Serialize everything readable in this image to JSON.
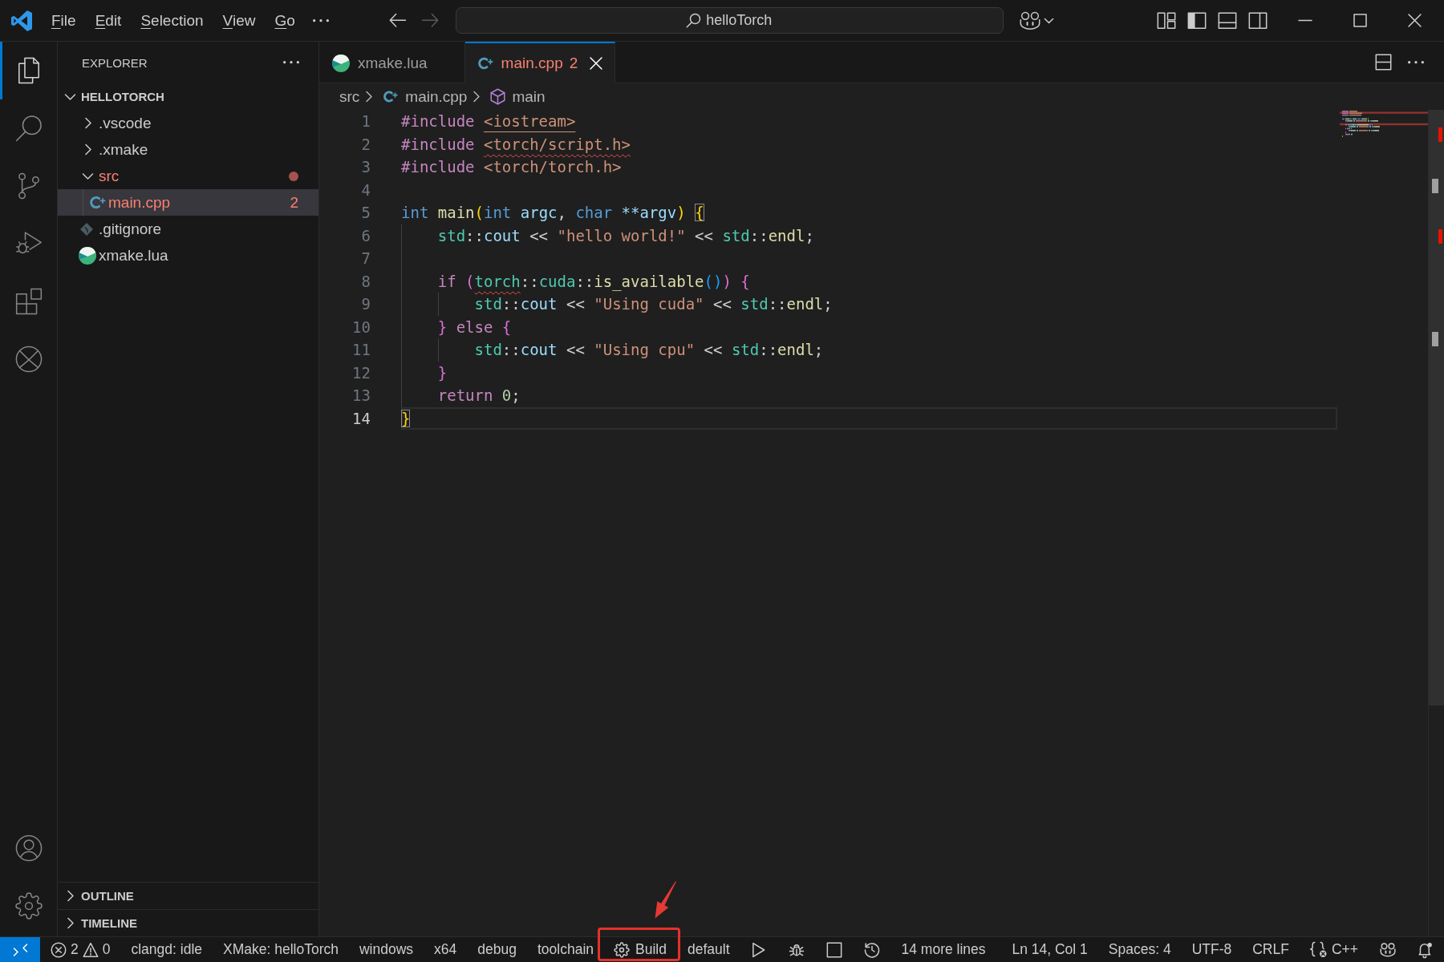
{
  "title_bar": {
    "menu": [
      "File",
      "Edit",
      "Selection",
      "View",
      "Go"
    ],
    "navigation": [
      {
        "kind": "back",
        "disabled": false
      },
      {
        "kind": "forward",
        "disabled": true
      }
    ],
    "command_center": {
      "label": "helloTorch"
    },
    "layout_toggles": [
      {
        "kind": "primary_sidebar",
        "on": true
      },
      {
        "kind": "panel",
        "on": false
      },
      {
        "kind": "secondary_sidebar",
        "on": false
      }
    ]
  },
  "activity_bar": {
    "items": [
      {
        "kind": "explorer",
        "selected": true
      },
      {
        "kind": "search",
        "selected": false
      },
      {
        "kind": "source_control",
        "selected": false
      },
      {
        "kind": "run_debug",
        "selected": false
      },
      {
        "kind": "extensions",
        "selected": false
      },
      {
        "kind": "xmake",
        "selected": false
      }
    ],
    "bottom": [
      {
        "kind": "accounts"
      },
      {
        "kind": "manage"
      }
    ]
  },
  "explorer": {
    "title": "EXPLORER",
    "sections": [
      {
        "title": "HELLOTORCH",
        "expanded": true,
        "tree": [
          {
            "label": ".vscode",
            "kind": "folder",
            "expanded": false,
            "selected": false,
            "error": false
          },
          {
            "label": ".xmake",
            "kind": "folder",
            "expanded": false,
            "selected": false,
            "error": false
          },
          {
            "label": "src",
            "kind": "folder",
            "expanded": true,
            "selected": false,
            "error": true,
            "children": [
              {
                "label": "main.cpp",
                "kind": "cpp",
                "selected": true,
                "error": true,
                "problems": "2"
              }
            ]
          },
          {
            "label": ".gitignore",
            "kind": "git",
            "selected": false,
            "error": false
          },
          {
            "label": "xmake.lua",
            "kind": "xmake",
            "selected": false,
            "error": false
          }
        ]
      },
      {
        "title": "OUTLINE",
        "expanded": false
      },
      {
        "title": "TIMELINE",
        "expanded": false
      }
    ]
  },
  "editor": {
    "tabs": [
      {
        "label": "xmake.lua",
        "kind": "xmake",
        "selected": false,
        "error": false
      },
      {
        "label": "main.cpp",
        "kind": "cpp",
        "selected": true,
        "error": true,
        "problems": "2"
      }
    ],
    "breadcrumbs": [
      {
        "label": "src",
        "kind": "folder"
      },
      {
        "label": "main.cpp",
        "kind": "cpp"
      },
      {
        "label": "main",
        "kind": "symbol"
      }
    ],
    "lines": [
      {
        "number": "1",
        "current": false,
        "tokens": [
          {
            "text": "#include ",
            "kind": "directive"
          },
          {
            "text": "<iostream>",
            "kind": "include_link"
          }
        ]
      },
      {
        "number": "2",
        "current": false,
        "tokens": [
          {
            "text": "#include ",
            "kind": "directive"
          },
          {
            "text": "<torch/script.h>",
            "kind": "include_error"
          }
        ]
      },
      {
        "number": "3",
        "current": false,
        "tokens": [
          {
            "text": "#include ",
            "kind": "directive"
          },
          {
            "text": "<torch/torch.h>",
            "kind": "include"
          }
        ]
      },
      {
        "number": "4",
        "current": false
      },
      {
        "number": "5",
        "current": false,
        "tokens": [
          {
            "text": "int ",
            "kind": "type"
          },
          {
            "text": "main",
            "kind": "function"
          },
          {
            "text": "(",
            "kind": "bracket1"
          },
          {
            "text": "int ",
            "kind": "type"
          },
          {
            "text": "argc",
            "kind": "param"
          },
          {
            "text": ", ",
            "kind": "plain"
          },
          {
            "text": "char ",
            "kind": "type"
          },
          {
            "text": "**argv",
            "kind": "param"
          },
          {
            "text": ") ",
            "kind": "bracket1"
          },
          {
            "text": "{",
            "kind": "bracket1_match"
          }
        ]
      },
      {
        "number": "6",
        "current": false,
        "tokens": [
          {
            "text": "    std",
            "kind": "namespace"
          },
          {
            "text": "::",
            "kind": "plain"
          },
          {
            "text": "cout",
            "kind": "variable"
          },
          {
            "text": " << ",
            "kind": "plain"
          },
          {
            "text": "\"hello world!\"",
            "kind": "string"
          },
          {
            "text": " << ",
            "kind": "plain"
          },
          {
            "text": "std",
            "kind": "namespace"
          },
          {
            "text": "::",
            "kind": "plain"
          },
          {
            "text": "endl",
            "kind": "function"
          },
          {
            "text": ";",
            "kind": "plain"
          }
        ]
      },
      {
        "number": "7",
        "current": false
      },
      {
        "number": "8",
        "current": false,
        "tokens": [
          {
            "text": "    if ",
            "kind": "keyword"
          },
          {
            "text": "(",
            "kind": "bracket2"
          },
          {
            "text": "torch",
            "kind": "namespace_error"
          },
          {
            "text": "::",
            "kind": "plain"
          },
          {
            "text": "cuda",
            "kind": "namespace"
          },
          {
            "text": "::",
            "kind": "plain"
          },
          {
            "text": "is_available",
            "kind": "function"
          },
          {
            "text": "()",
            "kind": "bracket3"
          },
          {
            "text": ") ",
            "kind": "bracket2"
          },
          {
            "text": "{",
            "kind": "bracket2"
          }
        ]
      },
      {
        "number": "9",
        "current": false,
        "tokens": [
          {
            "text": "        std",
            "kind": "namespace"
          },
          {
            "text": "::",
            "kind": "plain"
          },
          {
            "text": "cout",
            "kind": "variable"
          },
          {
            "text": " << ",
            "kind": "plain"
          },
          {
            "text": "\"Using cuda\"",
            "kind": "string"
          },
          {
            "text": " << ",
            "kind": "plain"
          },
          {
            "text": "std",
            "kind": "namespace"
          },
          {
            "text": "::",
            "kind": "plain"
          },
          {
            "text": "endl",
            "kind": "function"
          },
          {
            "text": ";",
            "kind": "plain"
          }
        ]
      },
      {
        "number": "10",
        "current": false,
        "tokens": [
          {
            "text": "    }",
            "kind": "bracket2"
          },
          {
            "text": " else ",
            "kind": "keyword"
          },
          {
            "text": "{",
            "kind": "bracket2"
          }
        ]
      },
      {
        "number": "11",
        "current": false,
        "tokens": [
          {
            "text": "        std",
            "kind": "namespace"
          },
          {
            "text": "::",
            "kind": "plain"
          },
          {
            "text": "cout",
            "kind": "variable"
          },
          {
            "text": " << ",
            "kind": "plain"
          },
          {
            "text": "\"Using cpu\"",
            "kind": "string"
          },
          {
            "text": " << ",
            "kind": "plain"
          },
          {
            "text": "std",
            "kind": "namespace"
          },
          {
            "text": "::",
            "kind": "plain"
          },
          {
            "text": "endl",
            "kind": "function"
          },
          {
            "text": ";",
            "kind": "plain"
          }
        ]
      },
      {
        "number": "12",
        "current": false,
        "tokens": [
          {
            "text": "    }",
            "kind": "bracket2"
          }
        ]
      },
      {
        "number": "13",
        "current": false,
        "tokens": [
          {
            "text": "    return ",
            "kind": "keyword"
          },
          {
            "text": "0",
            "kind": "number"
          },
          {
            "text": ";",
            "kind": "plain"
          }
        ]
      },
      {
        "number": "14",
        "current": true,
        "tokens": [
          {
            "text": "}",
            "kind": "bracket1_match"
          }
        ]
      }
    ]
  },
  "status_bar": {
    "left": [
      {
        "kind": "remote",
        "highlighted": false
      },
      {
        "kind": "problems",
        "errors": "2",
        "warnings": "0",
        "highlighted": false
      },
      {
        "kind": "text",
        "label": "clangd: idle",
        "highlighted": false
      },
      {
        "kind": "text",
        "label": "XMake: helloTorch",
        "highlighted": false
      },
      {
        "kind": "text",
        "label": "windows",
        "highlighted": false
      },
      {
        "kind": "text",
        "label": "x64",
        "highlighted": false
      },
      {
        "kind": "text",
        "label": "debug",
        "highlighted": false
      },
      {
        "kind": "text",
        "label": "toolchain",
        "highlighted": false
      },
      {
        "kind": "build",
        "label": "Build",
        "highlighted": true
      },
      {
        "kind": "text",
        "label": "default",
        "highlighted": false
      },
      {
        "kind": "run",
        "highlighted": false
      },
      {
        "kind": "debugger",
        "highlighted": false
      },
      {
        "kind": "stop",
        "highlighted": false
      },
      {
        "kind": "history",
        "highlighted": false
      },
      {
        "kind": "text",
        "label": "14 more lines",
        "highlighted": false
      }
    ],
    "right": [
      {
        "kind": "text",
        "label": "Ln 14, Col 1",
        "highlighted": false
      },
      {
        "kind": "text",
        "label": "Spaces: 4",
        "highlighted": false
      },
      {
        "kind": "text",
        "label": "UTF-8",
        "highlighted": false
      },
      {
        "kind": "text",
        "label": "CRLF",
        "highlighted": false
      },
      {
        "kind": "language",
        "label": "C++",
        "highlighted": false
      },
      {
        "kind": "copilot",
        "highlighted": false
      },
      {
        "kind": "notifications",
        "highlighted": false
      }
    ]
  }
}
